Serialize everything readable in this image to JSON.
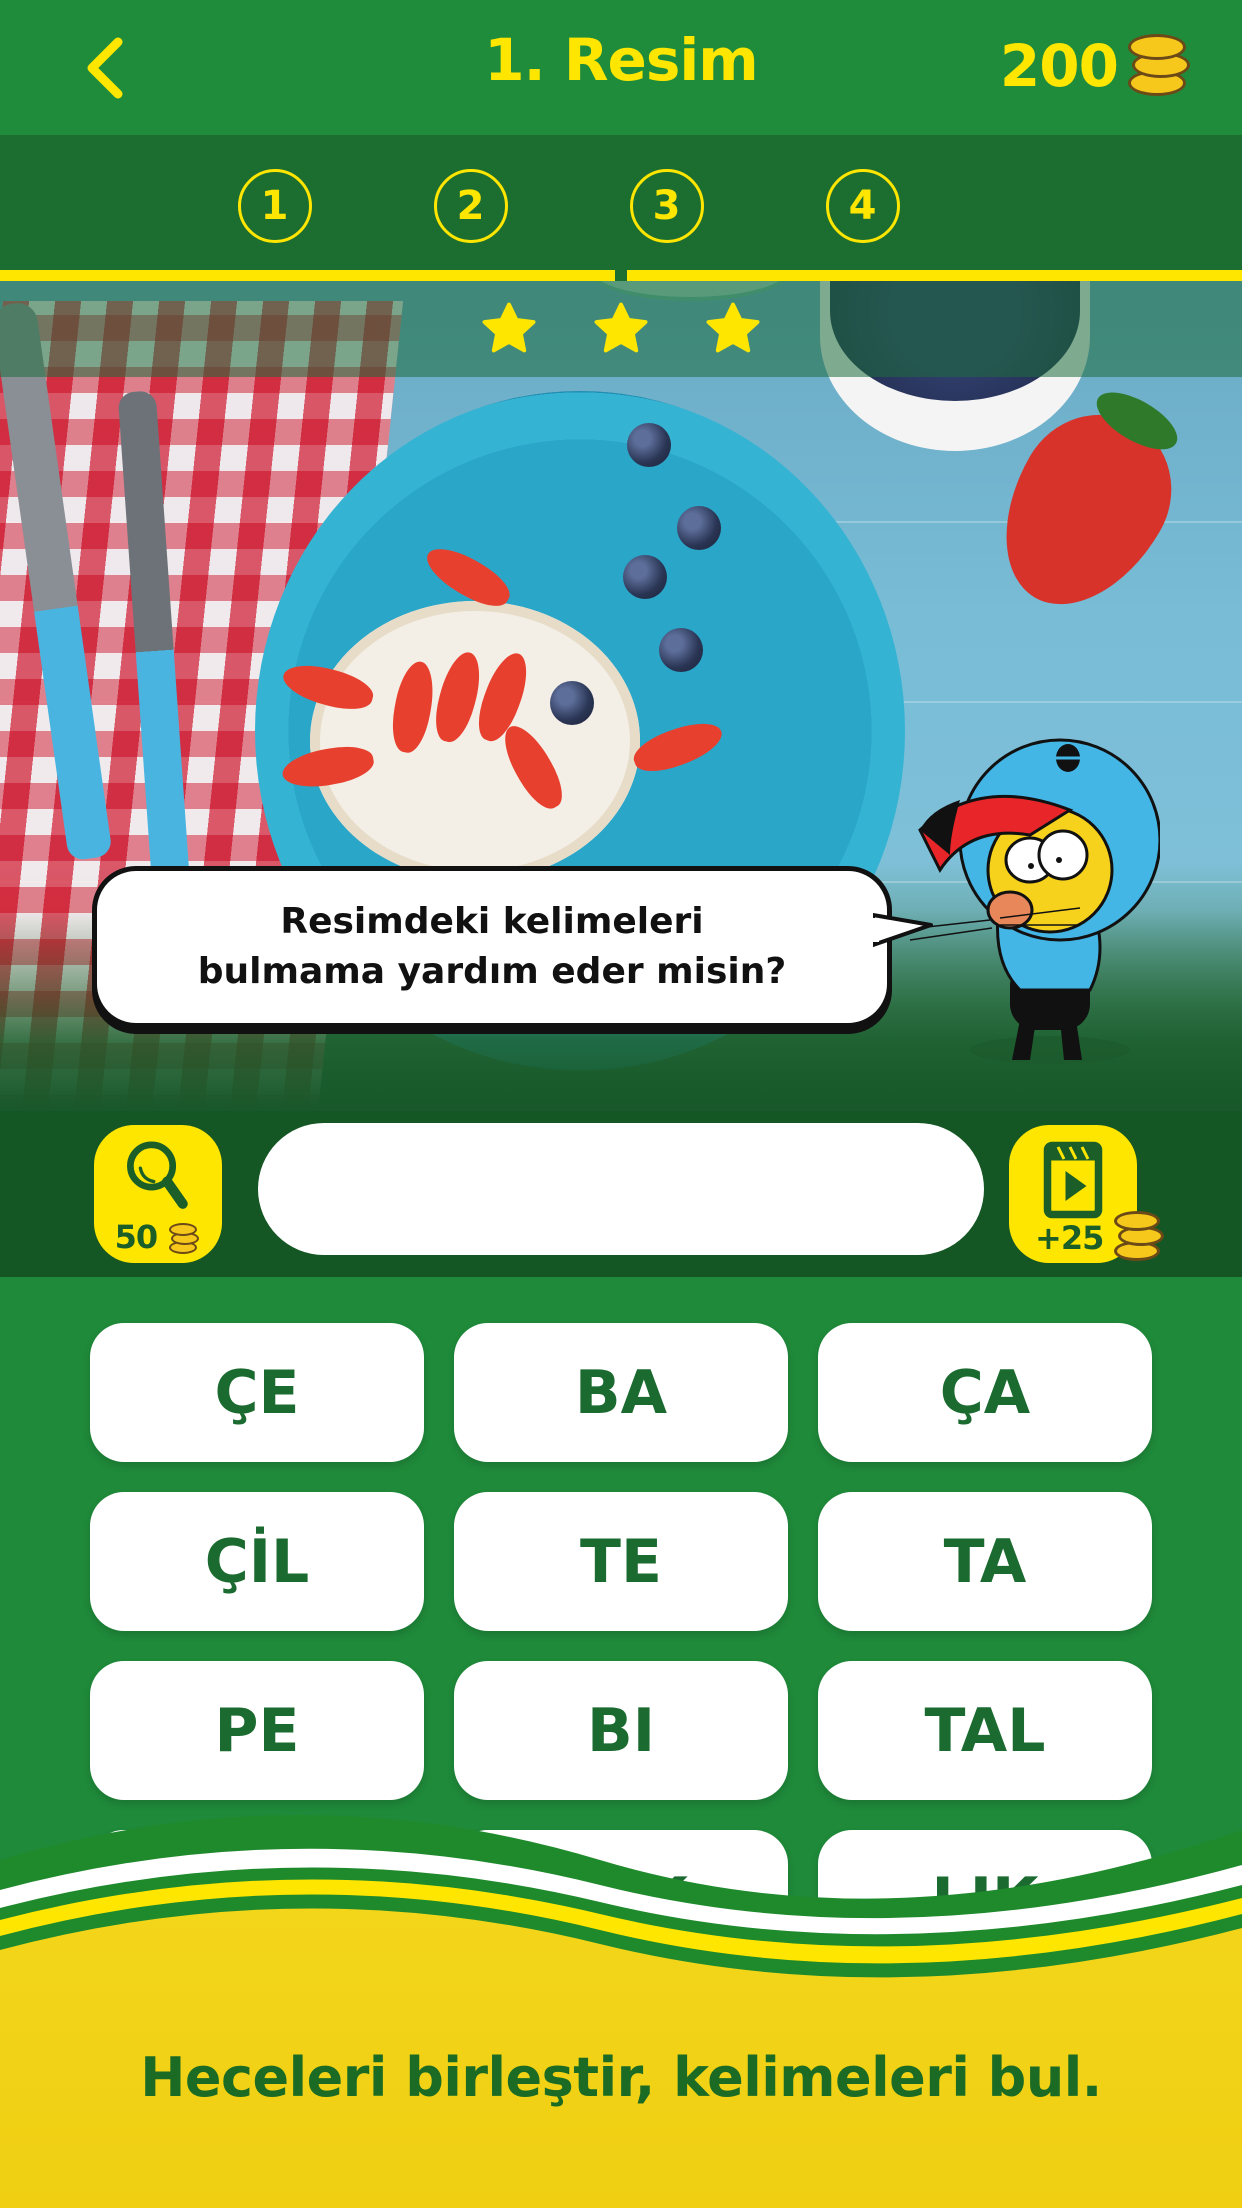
{
  "header": {
    "back_icon": "chevron-left-icon",
    "title": "1. Resim",
    "coins": "200",
    "coin_icon": "coin-stack-icon"
  },
  "levels": {
    "items": [
      "1",
      "2",
      "3",
      "4"
    ],
    "progress_fraction": 0.5
  },
  "rating": {
    "stars": 3,
    "max_stars": 3
  },
  "speech": {
    "line1": "Resimdeki kelimeleri",
    "line2": "bulmama yardım eder misin?"
  },
  "answer": {
    "value": "",
    "hint": {
      "icon": "magnifier-icon",
      "cost": "50"
    },
    "video": {
      "icon": "video-clapper-icon",
      "reward": "+25"
    }
  },
  "syllables": [
    "ÇE",
    "BA",
    "ÇA",
    "ÇİL",
    "TE",
    "TA",
    "PE",
    "BI",
    "TAL",
    "",
    "AK",
    "LIK"
  ],
  "footer": {
    "tagline": "Heceleri birleştir, kelimeleri bul."
  },
  "colors": {
    "primary_green": "#1f8c3b",
    "dark_green": "#155724",
    "accent_yellow": "#ffe600",
    "tile_text": "#1b6b30"
  }
}
